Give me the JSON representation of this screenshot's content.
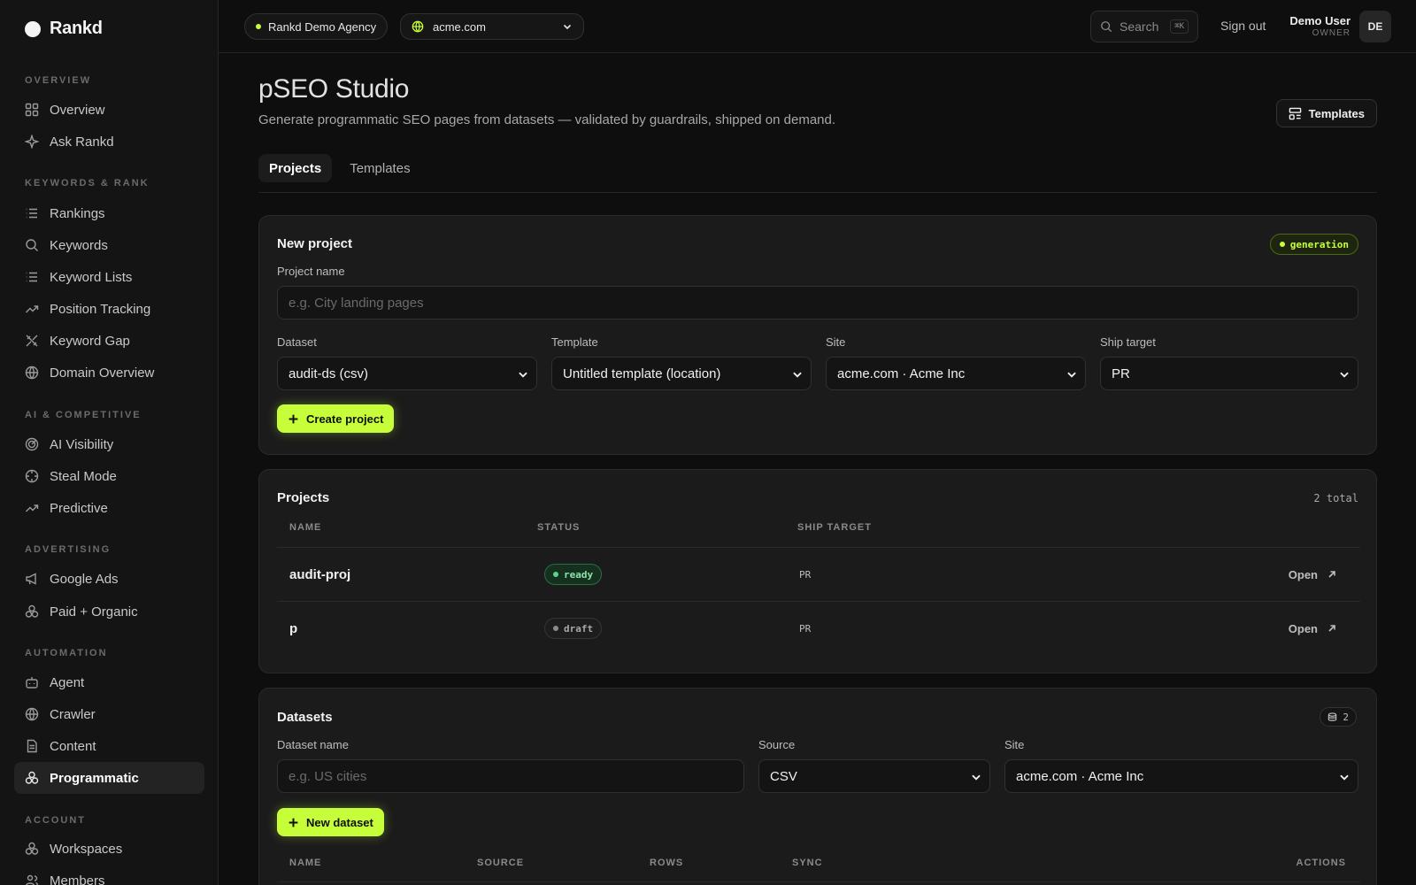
{
  "sidebar": {
    "brand": "Rankd",
    "sections": [
      {
        "title": "OVERVIEW"
      },
      {
        "title": "KEYWORDS & RANK"
      },
      {
        "title": "AI & COMPETITIVE"
      },
      {
        "title": "ADVERTISING"
      },
      {
        "title": "AUTOMATION"
      },
      {
        "title": "ACCOUNT"
      }
    ],
    "items": [
      {
        "label": "Overview",
        "icon": "grid-icon"
      },
      {
        "label": "Ask Rankd",
        "icon": "sparkle-icon"
      },
      {
        "label": "Rankings",
        "icon": "list-icon"
      },
      {
        "label": "Keywords",
        "icon": "search-icon"
      },
      {
        "label": "Keyword Lists",
        "icon": "list-icon"
      },
      {
        "label": "Position Tracking",
        "icon": "trend-up-icon"
      },
      {
        "label": "Keyword Gap",
        "icon": "gap-icon"
      },
      {
        "label": "Domain Overview",
        "icon": "globe-icon"
      },
      {
        "label": "AI Visibility",
        "icon": "radar-icon"
      },
      {
        "label": "Steal Mode",
        "icon": "crosshair-icon"
      },
      {
        "label": "Predictive",
        "icon": "trend-up-icon"
      },
      {
        "label": "Google Ads",
        "icon": "megaphone-icon"
      },
      {
        "label": "Paid + Organic",
        "icon": "blocks-icon"
      },
      {
        "label": "Agent",
        "icon": "bot-icon"
      },
      {
        "label": "Crawler",
        "icon": "globe-icon"
      },
      {
        "label": "Content",
        "icon": "document-icon"
      },
      {
        "label": "Programmatic",
        "icon": "blocks-icon",
        "active": true
      },
      {
        "label": "Workspaces",
        "icon": "blocks-icon"
      },
      {
        "label": "Members",
        "icon": "users-icon"
      }
    ]
  },
  "topbar": {
    "agency": "Rankd Demo Agency",
    "site": "acme.com",
    "search_placeholder": "Search",
    "search_shortcut": "⌘K",
    "sign_out": "Sign out",
    "user_name": "Demo User",
    "user_role": "OWNER",
    "avatar_initials": "DE"
  },
  "page": {
    "title": "pSEO Studio",
    "subtitle": "Generate programmatic SEO pages from datasets — validated by guardrails, shipped on demand.",
    "templates_button": "Templates",
    "tabs": [
      {
        "label": "Projects",
        "active": true
      },
      {
        "label": "Templates",
        "active": false
      }
    ]
  },
  "new_project": {
    "title": "New project",
    "badge": "generation",
    "name_label": "Project name",
    "name_placeholder": "e.g. City landing pages",
    "dataset_label": "Dataset",
    "dataset_value": "audit-ds (csv)",
    "template_label": "Template",
    "template_value": "Untitled template (location)",
    "site_label": "Site",
    "site_value": "acme.com · Acme Inc",
    "ship_label": "Ship target",
    "ship_value": "PR",
    "create_button": "Create project"
  },
  "projects": {
    "title": "Projects",
    "total": "2 total",
    "columns": [
      "NAME",
      "STATUS",
      "SHIP TARGET"
    ],
    "rows": [
      {
        "name": "audit-proj",
        "status": "ready",
        "ship_target": "PR",
        "action": "Open"
      },
      {
        "name": "p",
        "status": "draft",
        "ship_target": "PR",
        "action": "Open"
      }
    ]
  },
  "datasets": {
    "title": "Datasets",
    "count": "2",
    "name_label": "Dataset name",
    "name_placeholder": "e.g. US cities",
    "source_label": "Source",
    "source_value": "CSV",
    "site_label": "Site",
    "site_value": "acme.com · Acme Inc",
    "new_button": "New dataset",
    "columns": [
      "NAME",
      "SOURCE",
      "ROWS",
      "SYNC",
      "ACTIONS"
    ]
  },
  "colors": {
    "accent": "#c6ff3a",
    "background": "#0e0e0e",
    "card": "#1b1b1b",
    "ready": "#5bd38a"
  }
}
